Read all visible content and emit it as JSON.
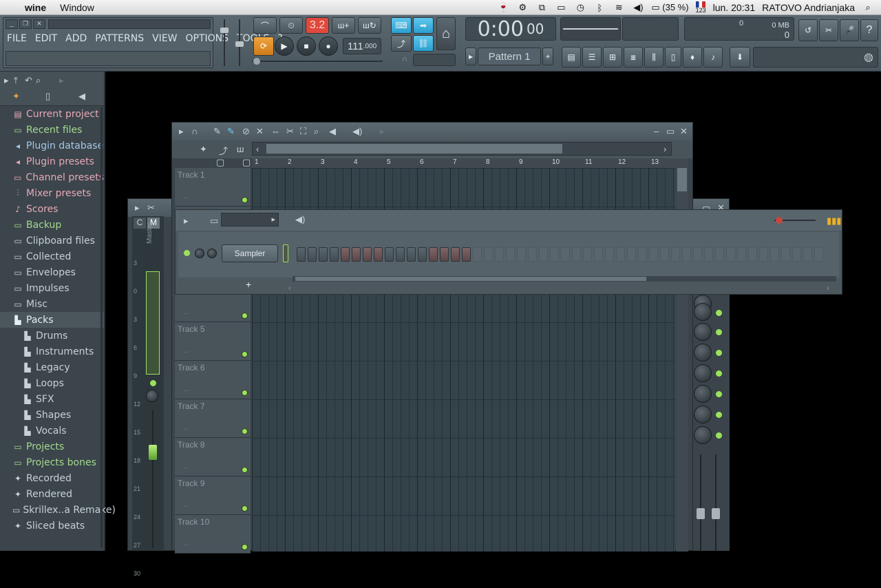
{
  "macbar": {
    "app": "wine",
    "menus": [
      "Window"
    ],
    "battery": "(35 %)",
    "clock": "lun. 20:31",
    "user": "RATOVO Andrianjaka",
    "keyboard_label": "123"
  },
  "fl": {
    "menus": [
      "FILE",
      "EDIT",
      "ADD",
      "PATTERNS",
      "VIEW",
      "OPTIONS",
      "TOOLS",
      "?"
    ],
    "tempo": "111",
    "tempo_decimal": ".000",
    "time": "0:00",
    "time_small": "00",
    "pattern": "Pattern 1",
    "snap": "3.2",
    "mem": "0 MB",
    "cpu": "0",
    "cpu2": "0"
  },
  "browser": {
    "items": [
      {
        "label": "Current project",
        "icon": "project-icon",
        "style": "pink",
        "sub": false
      },
      {
        "label": "Recent files",
        "icon": "folder-icon",
        "style": "green",
        "sub": false
      },
      {
        "label": "Plugin database",
        "icon": "plug-icon",
        "style": "blue",
        "sub": false
      },
      {
        "label": "Plugin presets",
        "icon": "plug-icon",
        "style": "pink",
        "sub": false
      },
      {
        "label": "Channel presets",
        "icon": "channel-icon",
        "style": "pink",
        "sub": false
      },
      {
        "label": "Mixer presets",
        "icon": "mixer-icon",
        "style": "pink",
        "sub": false
      },
      {
        "label": "Scores",
        "icon": "note-icon",
        "style": "pink",
        "sub": false
      },
      {
        "label": "Backup",
        "icon": "folder-icon",
        "style": "green",
        "sub": false
      },
      {
        "label": "Clipboard files",
        "icon": "folder-icon",
        "style": "",
        "sub": false
      },
      {
        "label": "Collected",
        "icon": "folder-icon",
        "style": "",
        "sub": false
      },
      {
        "label": "Envelopes",
        "icon": "folder-icon",
        "style": "",
        "sub": false
      },
      {
        "label": "Impulses",
        "icon": "folder-icon",
        "style": "",
        "sub": false
      },
      {
        "label": "Misc",
        "icon": "folder-icon",
        "style": "",
        "sub": false
      },
      {
        "label": "Packs",
        "icon": "pack-icon",
        "style": "sel",
        "sub": false
      },
      {
        "label": "Drums",
        "icon": "pack-icon",
        "style": "",
        "sub": true
      },
      {
        "label": "Instruments",
        "icon": "pack-icon",
        "style": "",
        "sub": true
      },
      {
        "label": "Legacy",
        "icon": "pack-icon",
        "style": "",
        "sub": true
      },
      {
        "label": "Loops",
        "icon": "pack-icon",
        "style": "",
        "sub": true
      },
      {
        "label": "SFX",
        "icon": "pack-icon",
        "style": "",
        "sub": true
      },
      {
        "label": "Shapes",
        "icon": "pack-icon",
        "style": "",
        "sub": true
      },
      {
        "label": "Vocals",
        "icon": "pack-icon",
        "style": "",
        "sub": true
      },
      {
        "label": "Projects",
        "icon": "folder-icon",
        "style": "green",
        "sub": false
      },
      {
        "label": "Projects bones",
        "icon": "folder-icon",
        "style": "green",
        "sub": false
      },
      {
        "label": "Recorded",
        "icon": "recorded-icon",
        "style": "",
        "sub": false
      },
      {
        "label": "Rendered",
        "icon": "recorded-icon",
        "style": "",
        "sub": false
      },
      {
        "label": "Skrillex..a Remake)",
        "icon": "folder-icon",
        "style": "",
        "sub": false
      },
      {
        "label": "Sliced beats",
        "icon": "recorded-icon",
        "style": "",
        "sub": false
      }
    ]
  },
  "playlist": {
    "ruler": [
      "1",
      "2",
      "3",
      "4",
      "5",
      "6",
      "7",
      "8",
      "9",
      "10",
      "11",
      "12",
      "13"
    ],
    "tracks": [
      {
        "label": "Track 1"
      },
      {
        "label": ""
      },
      {
        "label": ""
      },
      {
        "label": ""
      },
      {
        "label": "Track 5"
      },
      {
        "label": "Track 6"
      },
      {
        "label": "Track 7"
      },
      {
        "label": "Track 8"
      },
      {
        "label": "Track 9"
      },
      {
        "label": "Track 10"
      }
    ],
    "track_dots": "..."
  },
  "mixer": {
    "tab_c": "C",
    "tab_m": "M",
    "master_label": "Master",
    "scale": [
      "3",
      "0",
      "3",
      "6",
      "9",
      "12",
      "15",
      "18",
      "21",
      "24",
      "27",
      "30"
    ]
  },
  "rack": {
    "channel_name": "Sampler",
    "add_label": "+",
    "steps": [
      "dark",
      "dark",
      "dark",
      "dark",
      "red",
      "red",
      "red",
      "red",
      "dark",
      "dark",
      "dark",
      "dark",
      "red",
      "red",
      "red",
      "red",
      "faint",
      "faint",
      "faint",
      "faint",
      "faint",
      "faint",
      "faint",
      "faint",
      "faint",
      "faint",
      "faint",
      "faint",
      "faint",
      "faint",
      "faint",
      "faint",
      "faint",
      "faint",
      "faint",
      "faint",
      "faint",
      "faint",
      "faint",
      "faint",
      "faint",
      "faint",
      "faint",
      "faint",
      "faint",
      "faint",
      "faint",
      "faint"
    ]
  }
}
